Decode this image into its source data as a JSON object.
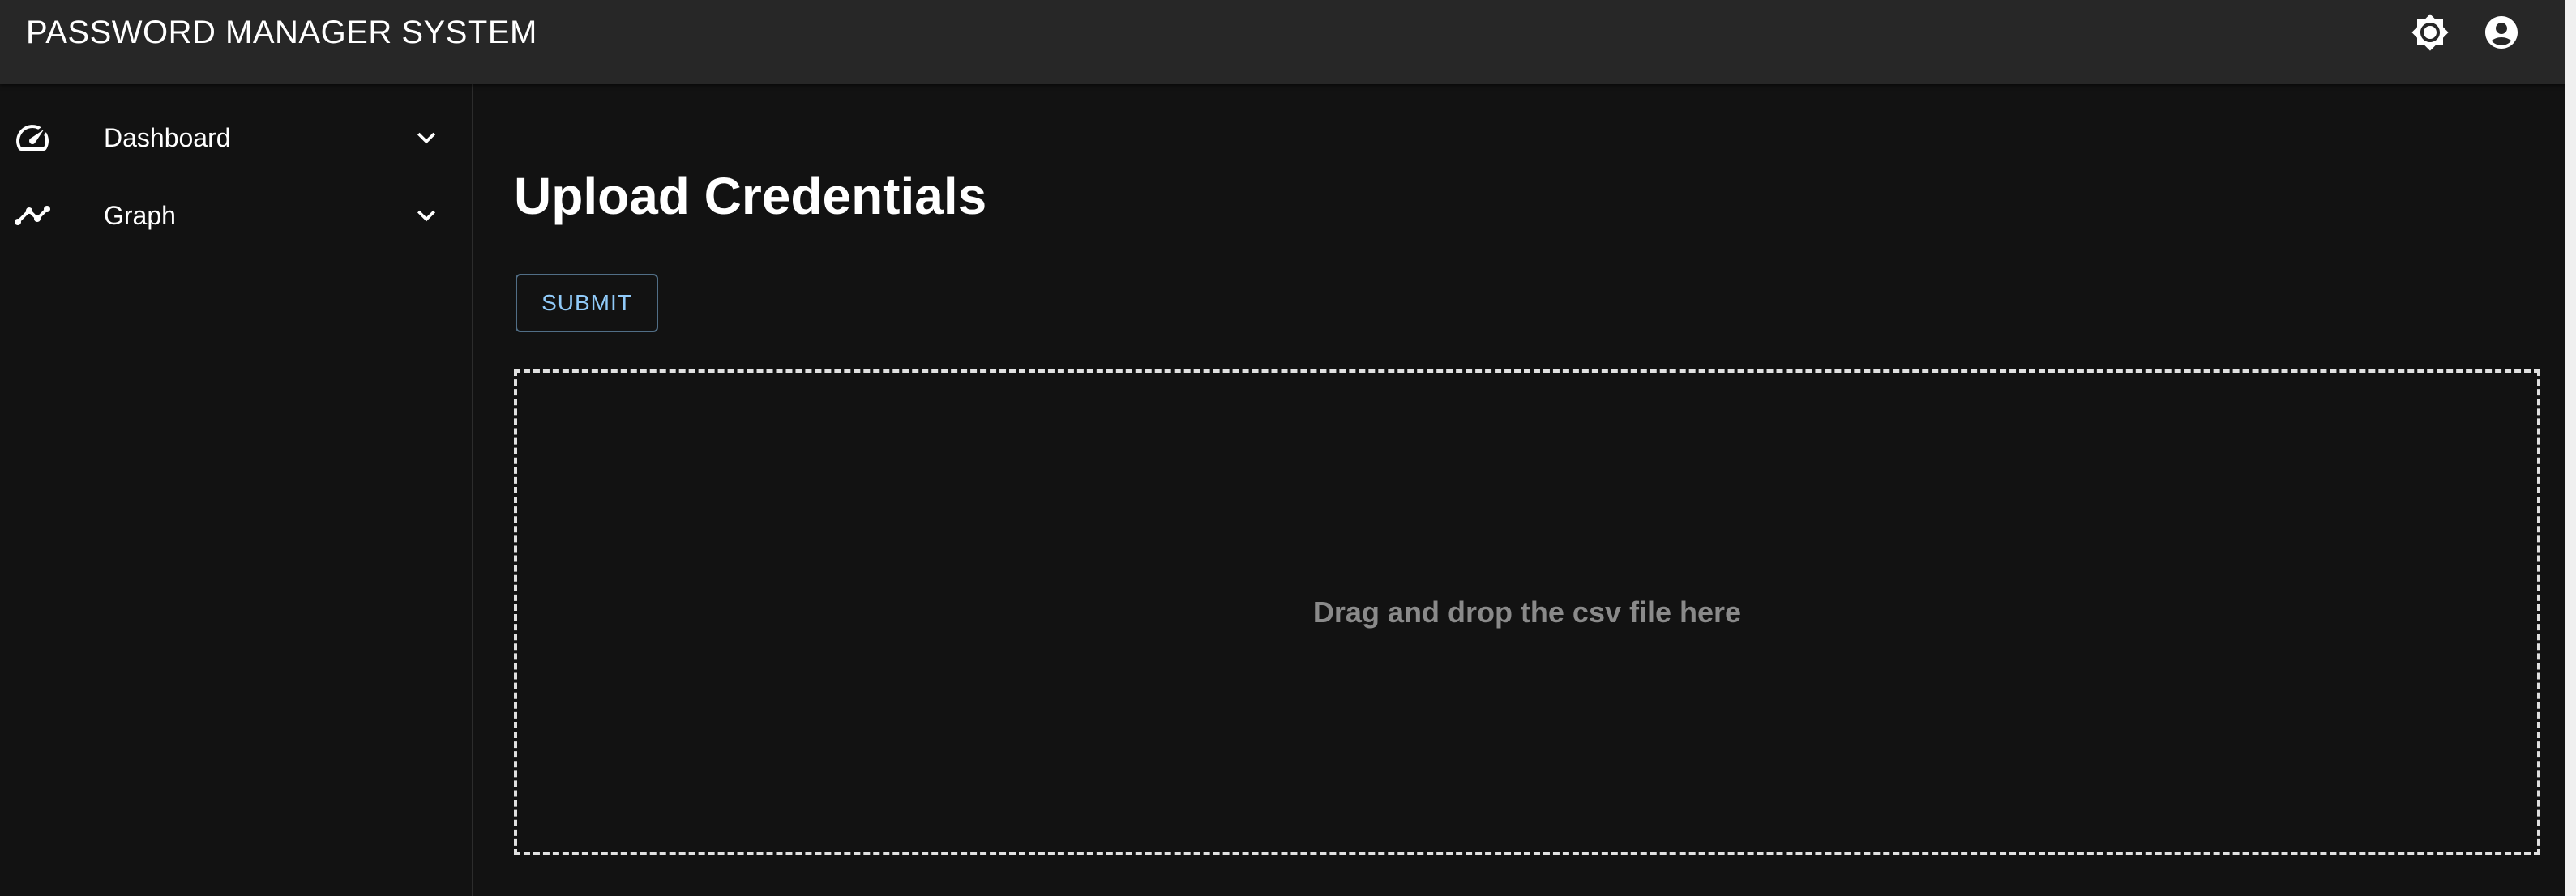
{
  "app": {
    "title": "PASSWORD MANAGER SYSTEM",
    "toolbar_icons": [
      "brightness-icon",
      "account-circle-icon"
    ]
  },
  "sidebar": {
    "items": [
      {
        "label": "Dashboard",
        "icon": "speedometer-icon",
        "expand_icon": "chevron-down-icon"
      },
      {
        "label": "Graph",
        "icon": "trending-line-icon",
        "expand_icon": "chevron-down-icon"
      }
    ]
  },
  "main": {
    "title": "Upload Credentials",
    "submit_label": "SUBMIT",
    "dropzone_text": "Drag and drop the csv file here"
  },
  "colors": {
    "appbar": "#272727",
    "background": "#121212",
    "accent": "#90caf9",
    "dropzone_border": "#e0e0e0",
    "dropzone_text": "#8a8a8a"
  }
}
